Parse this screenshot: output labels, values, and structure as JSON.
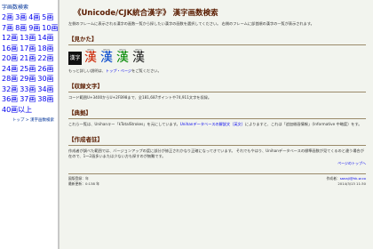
{
  "left": {
    "title": "字画数検索",
    "strokes": [
      [
        "2画",
        "3画",
        "4画",
        "5画"
      ],
      [
        "7画",
        "8画",
        "9画",
        "10画"
      ],
      [
        "12画",
        "13画",
        "14画"
      ],
      [
        "16画",
        "17画",
        "18画"
      ],
      [
        "20画",
        "21画",
        "22画"
      ],
      [
        "24画",
        "25画",
        "26画"
      ],
      [
        "28画",
        "29画",
        "30画"
      ],
      [
        "32画",
        "33画",
        "34画"
      ],
      [
        "36画",
        "37画",
        "38画"
      ],
      [
        "40画以上"
      ]
    ],
    "footer": "トップ > 漢字画数検索"
  },
  "main": {
    "title": "《Unicode/CJK統合漢字》 漢字画数検索",
    "intro": "左側のフレームに表示される漢字の画数一覧から探したい漢字の画数を選択してください。 右側のフレームに部首順の漢字の一覧が表示されます。",
    "view_heading": "【見かた】",
    "seal_text": "漢字",
    "chars": [
      {
        "code": "6F22",
        "glyph": "漢",
        "color": "#cc2200"
      },
      {
        "code": "6F22",
        "glyph": "漢",
        "color": "#0044cc"
      },
      {
        "code": "6F22",
        "glyph": "漢",
        "color": "#008800"
      },
      {
        "code": "6F22",
        "glyph": "漢",
        "color": "#222222"
      }
    ],
    "view_note_prefix": "もっと詳しい説明は、",
    "view_note_link": "トップ・ページ",
    "view_note_suffix": "をご覧ください。",
    "scope_heading": "【収録文字】",
    "scope_text": "コード範囲U+3400からU+2FB98まで、全181,687ポイントや74,911文字を収録。",
    "source_heading": "【典拠】",
    "source_prefix": "これら一覧は、Unihanキー「kTotalStrokes」を元にしています。",
    "source_link": "Unihanデータベースの解説文（英文）",
    "source_suffix": "によりますと、これは「追加総画情報」（Informative 中略度）をす。",
    "notes_heading": "【作成者註】",
    "notes_text": "作成者が調べた範囲では、バージョンアップの度に部分が修正されかなり正確になってきています。 それでもやはり、Unihanデータベースの標準画数が見てくるのと違う場合が在ので、1〜2画多いまたは少ない方も探すのが無難です。",
    "page_top": "ページのトップへ",
    "footer_left": [
      "図版登録：年",
      "最新更新：0:138 年"
    ],
    "footer_right_prefix": "作成者：",
    "footer_right_link": "sanaji@hk-w.co",
    "footer_right_date": "2014/3/13 11:30"
  }
}
